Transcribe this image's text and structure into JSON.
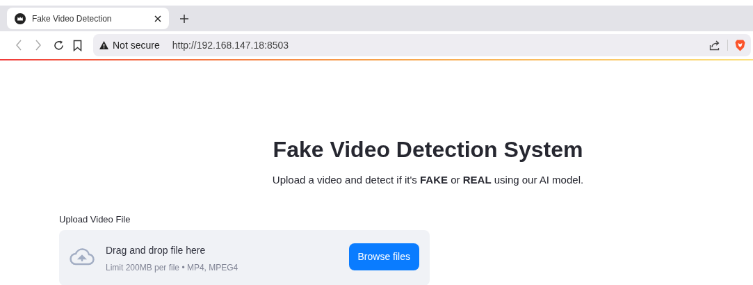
{
  "browser": {
    "tab": {
      "title": "Fake Video Detection",
      "selected": true
    },
    "security_label": "Not secure",
    "url": "http://192.168.147.18:8503"
  },
  "page": {
    "title": "Fake Video Detection System",
    "subtitle": "Upload a video and detect if it's **FAKE** or **REAL** using our AI model.",
    "uploader": {
      "label": "Upload Video File",
      "dropzone_text": "Drag and drop file here",
      "limit_text": "Limit 200MB per file • MP4, MPEG4",
      "button": "Browse files"
    }
  }
}
